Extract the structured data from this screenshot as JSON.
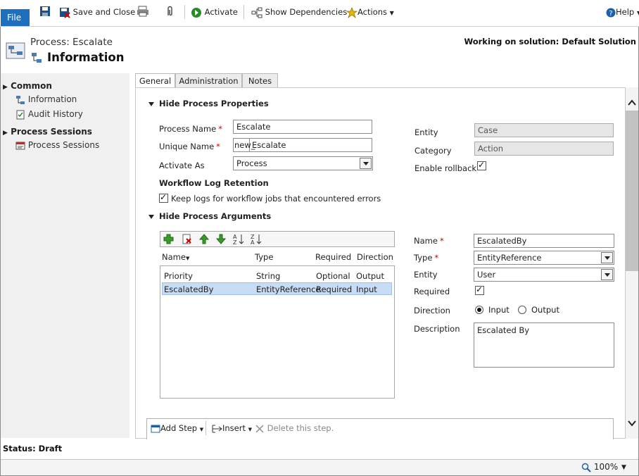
{
  "toolbar": {
    "file_label": "File",
    "save_close_label": "Save and Close",
    "activate_label": "Activate",
    "show_dependencies_label": "Show Dependencies",
    "actions_label": "Actions",
    "help_label": "Help"
  },
  "header": {
    "entity_label": "Process: Escalate",
    "form_title": "Information",
    "solution_text": "Working on solution: Default Solution"
  },
  "sidebar": {
    "groups": [
      {
        "title": "Common",
        "items": [
          {
            "label": "Information",
            "icon": "process-icon"
          },
          {
            "label": "Audit History",
            "icon": "audit-icon"
          }
        ]
      },
      {
        "title": "Process Sessions",
        "items": [
          {
            "label": "Process Sessions",
            "icon": "sessions-icon"
          }
        ]
      }
    ]
  },
  "tabs": [
    {
      "label": "General",
      "active": true
    },
    {
      "label": "Administration",
      "active": false
    },
    {
      "label": "Notes",
      "active": false
    }
  ],
  "properties": {
    "section_title": "Hide Process Properties",
    "process_name_label": "Process Name",
    "process_name_value": "Escalate",
    "unique_name_label": "Unique Name",
    "unique_name_prefix": "new_",
    "unique_name_value": "Escalate",
    "activate_as_label": "Activate As",
    "activate_as_value": "Process",
    "entity_label": "Entity",
    "entity_value": "Case",
    "category_label": "Category",
    "category_value": "Action",
    "enable_rollback_label": "Enable rollback",
    "enable_rollback_checked": true,
    "log_retention_title": "Workflow Log Retention",
    "keep_logs_label": "Keep logs for workflow jobs that encountered errors",
    "keep_logs_checked": true
  },
  "arguments": {
    "section_title": "Hide Process Arguments",
    "columns": [
      "Name",
      "Type",
      "Required",
      "Direction"
    ],
    "rows": [
      {
        "name": "Priority",
        "type": "String",
        "required": "Optional",
        "direction": "Output",
        "selected": false
      },
      {
        "name": "EscalatedBy",
        "type": "EntityReference",
        "required": "Required",
        "direction": "Input",
        "selected": true
      }
    ],
    "detail": {
      "name_label": "Name",
      "name_value": "EscalatedBy",
      "type_label": "Type",
      "type_value": "EntityReference",
      "entity_label": "Entity",
      "entity_value": "User",
      "required_label": "Required",
      "required_checked": true,
      "direction_label": "Direction",
      "direction_input_label": "Input",
      "direction_output_label": "Output",
      "direction_selected": "Input",
      "description_label": "Description",
      "description_value": "Escalated By"
    }
  },
  "steps": {
    "add_step_label": "Add Step",
    "insert_label": "Insert",
    "delete_label": "Delete this step."
  },
  "status": {
    "text": "Status: Draft"
  },
  "zoom": {
    "label": "100%"
  },
  "colors": {
    "accent": "#1f6fbf",
    "selected_row": "#c7dcf5",
    "required_star": "#cc0000"
  }
}
